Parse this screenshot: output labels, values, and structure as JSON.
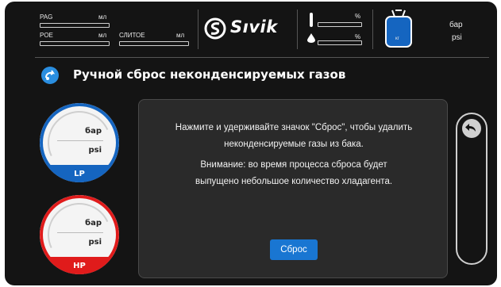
{
  "header": {
    "pag_label": "PAG",
    "poe_label": "POE",
    "oil_label": "СЛИТОЕ",
    "unit_ml_1": "мл",
    "unit_ml_2": "мл",
    "unit_ml_3": "мл",
    "percent_1": "%",
    "percent_2": "%",
    "brand": "Sıvik",
    "tank_pressure_bar": "бар",
    "tank_pressure_psi": "psi",
    "tank_label": "кг"
  },
  "title": "Ручной сброс неконденсируемых газов",
  "gauges": [
    {
      "unit_bar": "бар",
      "unit_psi": "psi",
      "tag": "LP",
      "color": "#1565c0"
    },
    {
      "unit_bar": "бар",
      "unit_psi": "psi",
      "tag": "HP",
      "color": "#e01b1b"
    }
  ],
  "panel": {
    "line1": "Нажмите и удерживайте значок \"Сброс\", чтобы удалить",
    "line2": "неконденсируемые газы из бака.",
    "line3": "Внимание: во время процесса сброса будет",
    "line4": "выпущено небольшое количество хладагента.",
    "reset_label": "Сброс"
  },
  "colors": {
    "accent": "#1976d2",
    "background": "#141414",
    "lp": "#1565c0",
    "hp": "#e01b1b"
  }
}
